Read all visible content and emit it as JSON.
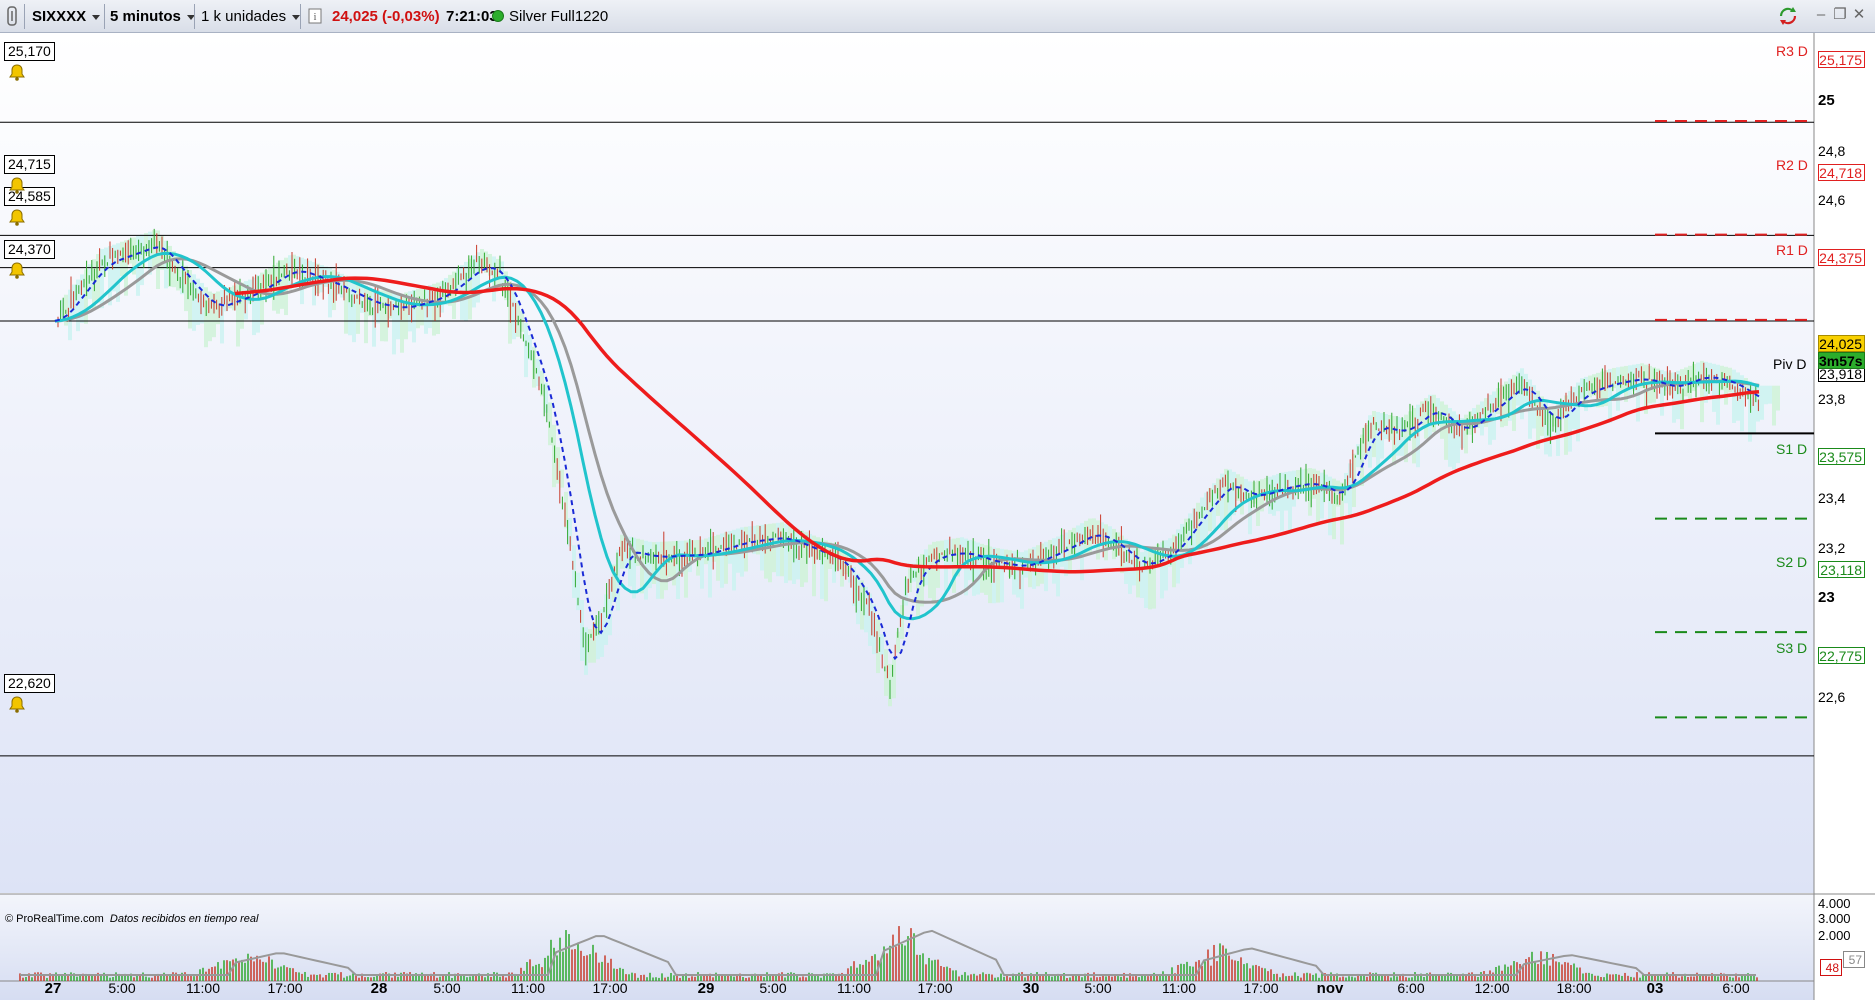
{
  "toolbar": {
    "symbol": "SIXXXX",
    "timeframe": "5 minutos",
    "units": "1 k unidades",
    "price_change": "24,025 (-0,03%)",
    "time": "7:21:03",
    "status": "Silver Full1220"
  },
  "chart": {
    "levels": [
      {
        "value": "25,170"
      },
      {
        "value": "24,715"
      },
      {
        "value": "24,585"
      },
      {
        "value": "24,370"
      },
      {
        "value": "22,620"
      }
    ],
    "pivots": [
      {
        "label": "R3 D",
        "value": "25,175",
        "color": "#e02020"
      },
      {
        "label": "R2 D",
        "value": "24,718",
        "color": "#e02020"
      },
      {
        "label": "R1 D",
        "value": "24,375",
        "color": "#e02020"
      },
      {
        "label": "Piv D",
        "value": "23,918",
        "color": "#000000"
      },
      {
        "label": "S1 D",
        "value": "23,575",
        "color": "#1a8a1a"
      },
      {
        "label": "S2 D",
        "value": "23,118",
        "color": "#1a8a1a"
      },
      {
        "label": "S3 D",
        "value": "22,775",
        "color": "#1a8a1a"
      }
    ],
    "price_axis": [
      {
        "label": "25",
        "bold": true
      },
      {
        "label": "24,8",
        "bold": false
      },
      {
        "label": "24,6",
        "bold": false
      },
      {
        "label": "23,8",
        "bold": false
      },
      {
        "label": "23,4",
        "bold": false
      },
      {
        "label": "23,2",
        "bold": false
      },
      {
        "label": "23",
        "bold": true
      },
      {
        "label": "22,6",
        "bold": false
      }
    ],
    "current_price": "24,025",
    "countdown": "3m57s",
    "volume_axis": [
      "4.000",
      "3.000",
      "2.000"
    ],
    "volume_tags": [
      "48",
      "57"
    ],
    "time_axis": [
      {
        "label": "27",
        "bold": true
      },
      {
        "label": "5:00",
        "bold": false
      },
      {
        "label": "11:00",
        "bold": false
      },
      {
        "label": "17:00",
        "bold": false
      },
      {
        "label": "28",
        "bold": true
      },
      {
        "label": "5:00",
        "bold": false
      },
      {
        "label": "11:00",
        "bold": false
      },
      {
        "label": "17:00",
        "bold": false
      },
      {
        "label": "29",
        "bold": true
      },
      {
        "label": "5:00",
        "bold": false
      },
      {
        "label": "11:00",
        "bold": false
      },
      {
        "label": "17:00",
        "bold": false
      },
      {
        "label": "30",
        "bold": true
      },
      {
        "label": "5:00",
        "bold": false
      },
      {
        "label": "11:00",
        "bold": false
      },
      {
        "label": "17:00",
        "bold": false
      },
      {
        "label": "nov",
        "bold": true
      },
      {
        "label": "6:00",
        "bold": false
      },
      {
        "label": "12:00",
        "bold": false
      },
      {
        "label": "18:00",
        "bold": false
      },
      {
        "label": "03",
        "bold": true
      },
      {
        "label": "6:00",
        "bold": false
      }
    ],
    "footer_brand": "© ProRealTime.com",
    "footer_note": "Datos recibidos en tiempo real",
    "colors": {
      "ma_red": "#ee1c1c",
      "ma_cyan": "#21c4cc",
      "ma_gray": "#9a9a9a",
      "ma_blue_dash": "#1a2ad6",
      "candle_up": "#2fa82f",
      "candle_down": "#c83a2a"
    }
  }
}
